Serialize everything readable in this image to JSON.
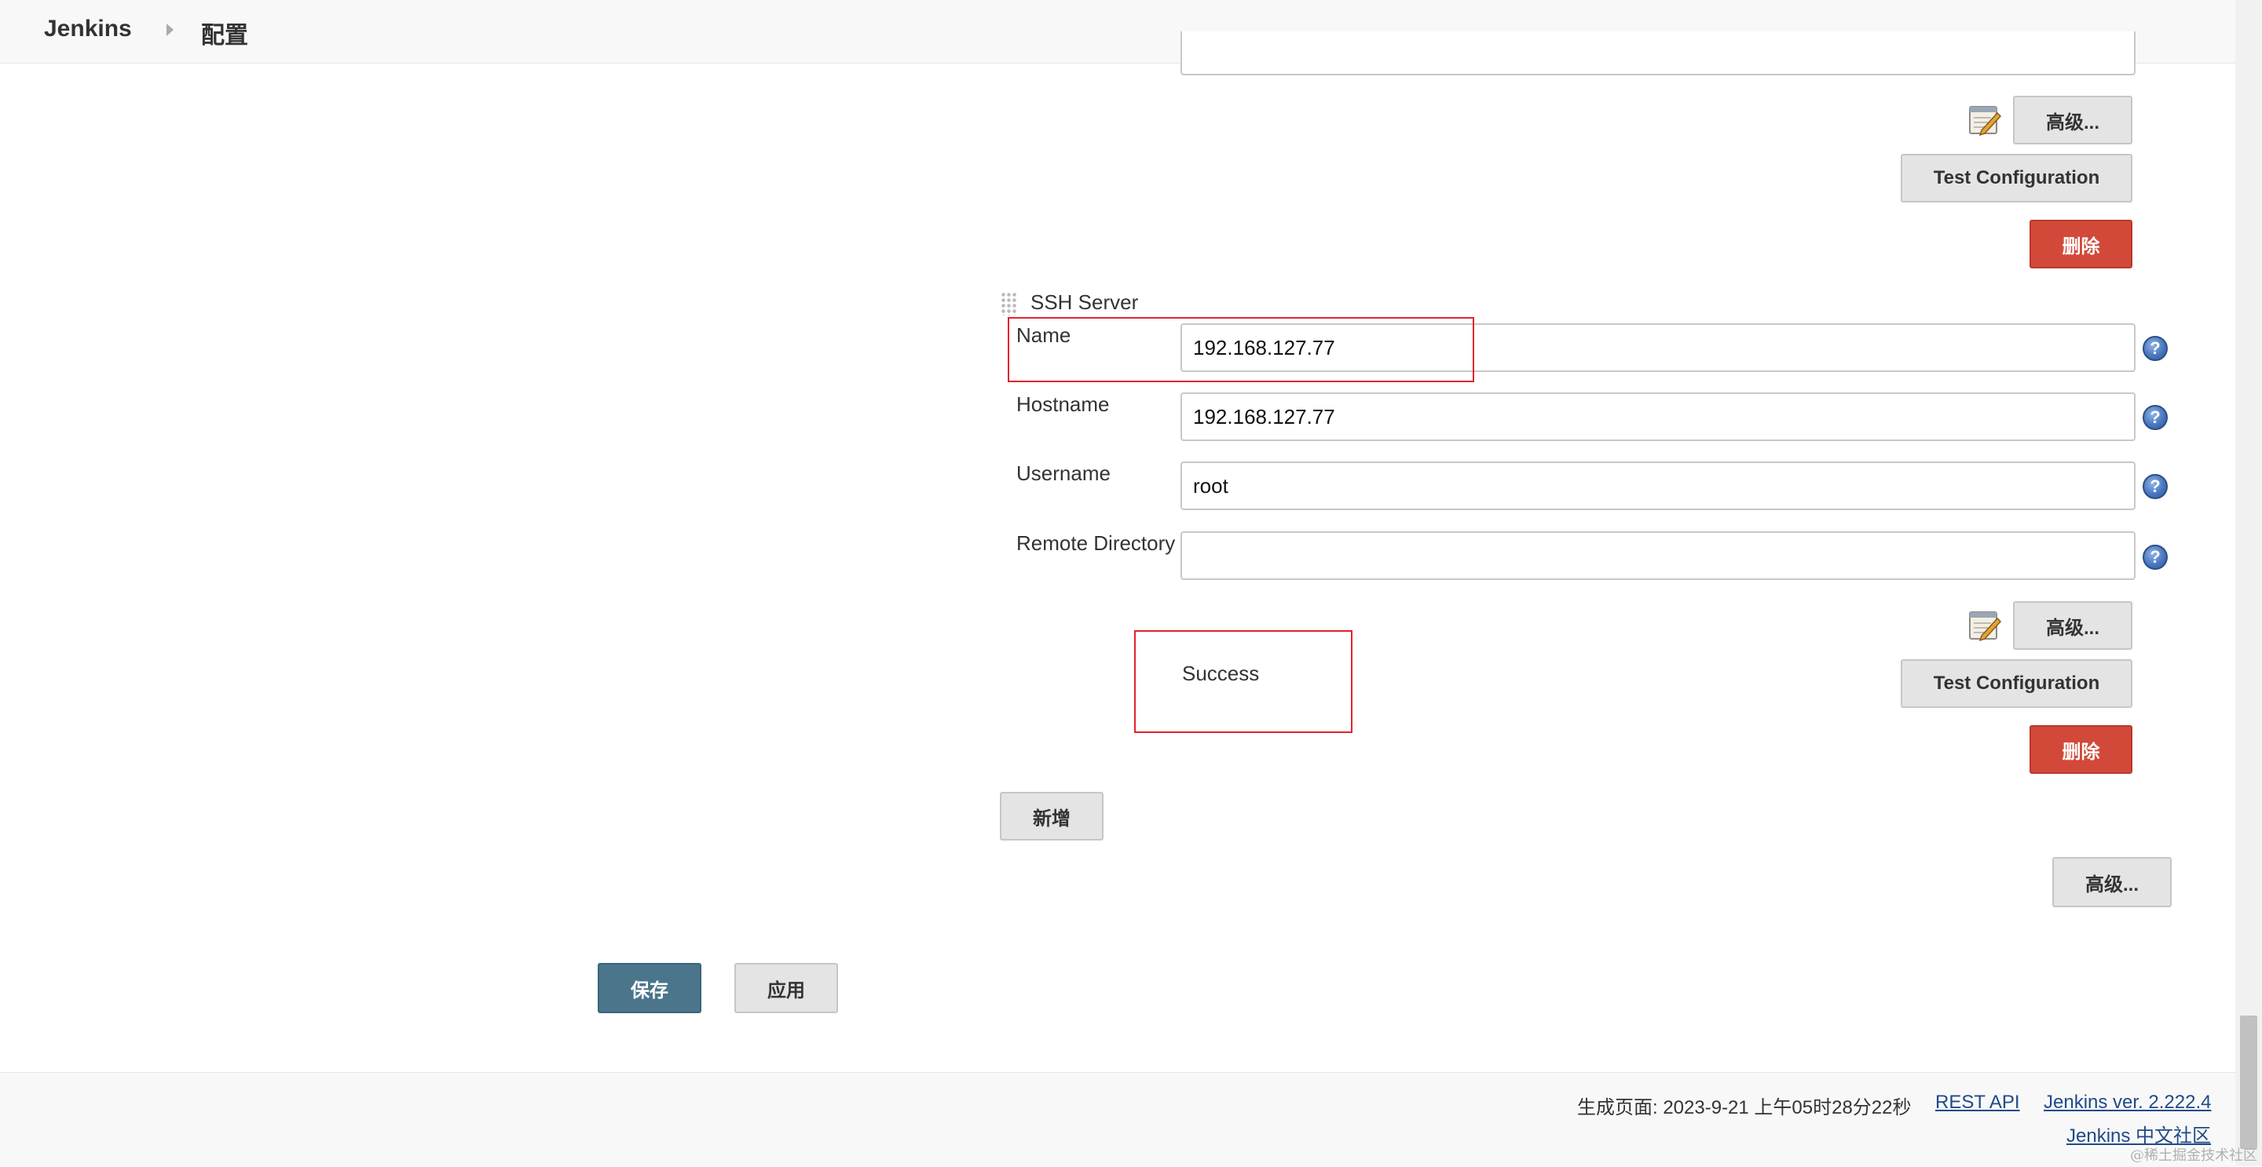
{
  "header": {
    "app_name": "Jenkins",
    "page": "配置"
  },
  "server_above": {
    "advanced_label": "高级...",
    "test_label": "Test Configuration",
    "delete_label": "删除"
  },
  "ssh_server": {
    "section_title": "SSH Server",
    "fields": {
      "name": {
        "label": "Name",
        "value": "192.168.127.77"
      },
      "hostname": {
        "label": "Hostname",
        "value": "192.168.127.77"
      },
      "username": {
        "label": "Username",
        "value": "root"
      },
      "remote_directory": {
        "label": "Remote Directory",
        "value": ""
      }
    },
    "help_glyph": "?",
    "status_text": "Success",
    "advanced_label": "高级...",
    "test_label": "Test Configuration",
    "delete_label": "删除"
  },
  "add_label": "新增",
  "section_advanced_label": "高级...",
  "actions": {
    "save_label": "保存",
    "apply_label": "应用"
  },
  "footer": {
    "generated": "生成页面: 2023-9-21 上午05时28分22秒",
    "rest_api": "REST API",
    "version": "Jenkins ver. 2.222.4",
    "community": "Jenkins 中文社区"
  },
  "watermark": "@稀土掘金技术社区",
  "icons": {
    "breadcrumb_separator": "chevron-right-icon",
    "notepad": "notepad-edit-icon",
    "help": "help-icon",
    "drag": "drag-handle-icon"
  },
  "colors": {
    "danger": "#d24939",
    "primary": "#4b758b",
    "highlight": "#e0242c",
    "link": "#204a87"
  }
}
